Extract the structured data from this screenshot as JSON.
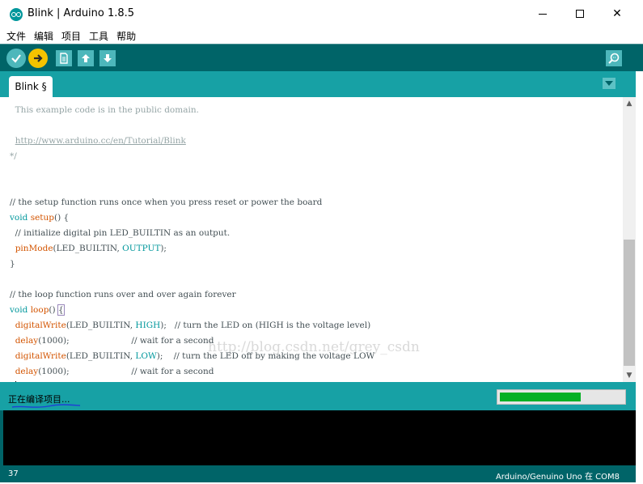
{
  "window": {
    "title": "Blink | Arduino 1.8.5",
    "min_icon": "minimize-icon",
    "max_icon": "maximize-icon",
    "close_label": "✕"
  },
  "menu": [
    "文件",
    "编辑",
    "项目",
    "工具",
    "帮助"
  ],
  "toolbar": {
    "buttons": [
      "verify-icon",
      "upload-icon",
      "new-icon",
      "open-icon",
      "save-icon",
      "serial-monitor-icon"
    ],
    "colors": {
      "background": "#006468",
      "button": "#4db7bb",
      "active": "#f4c300"
    }
  },
  "tabs": [
    {
      "label": "Blink §"
    }
  ],
  "editor": {
    "lines": [
      [
        {
          "t": "  This example code is in the public domain.",
          "c": "c-comment"
        }
      ],
      [],
      [
        {
          "t": "  ",
          "c": ""
        },
        {
          "t": "http://www.arduino.cc/en/Tutorial/Blink",
          "c": "c-link"
        }
      ],
      [
        {
          "t": "*/",
          "c": "c-comment"
        }
      ],
      [],
      [],
      [
        {
          "t": "// the setup function runs once when you press reset or power the board",
          "c": ""
        }
      ],
      [
        {
          "t": "void",
          "c": "c-type"
        },
        {
          "t": " ",
          "c": ""
        },
        {
          "t": "setup",
          "c": "c-func"
        },
        {
          "t": "() {",
          "c": ""
        }
      ],
      [
        {
          "t": "  // initialize digital pin LED_BUILTIN as an output.",
          "c": ""
        }
      ],
      [
        {
          "t": "  ",
          "c": ""
        },
        {
          "t": "pinMode",
          "c": "c-func"
        },
        {
          "t": "(LED_BUILTIN, ",
          "c": ""
        },
        {
          "t": "OUTPUT",
          "c": "c-const"
        },
        {
          "t": ");",
          "c": ""
        }
      ],
      [
        {
          "t": "}",
          "c": ""
        }
      ],
      [],
      [
        {
          "t": "// the loop function runs over and over again forever",
          "c": ""
        }
      ],
      [
        {
          "t": "void",
          "c": "c-type"
        },
        {
          "t": " ",
          "c": ""
        },
        {
          "t": "loop",
          "c": "c-func"
        },
        {
          "t": "() ",
          "c": ""
        },
        {
          "t": "{",
          "c": "brace-hl"
        }
      ],
      [
        {
          "t": "  ",
          "c": ""
        },
        {
          "t": "digitalWrite",
          "c": "c-func"
        },
        {
          "t": "(LED_BUILTIN, ",
          "c": ""
        },
        {
          "t": "HIGH",
          "c": "c-const"
        },
        {
          "t": ");   // turn the LED on (HIGH is the voltage level)",
          "c": ""
        }
      ],
      [
        {
          "t": "  ",
          "c": ""
        },
        {
          "t": "delay",
          "c": "c-func"
        },
        {
          "t": "(1000);                       // wait for a second",
          "c": ""
        }
      ],
      [
        {
          "t": "  ",
          "c": ""
        },
        {
          "t": "digitalWrite",
          "c": "c-func"
        },
        {
          "t": "(LED_BUILTIN, ",
          "c": ""
        },
        {
          "t": "LOW",
          "c": "c-const"
        },
        {
          "t": ");    // turn the LED off by making the voltage LOW",
          "c": ""
        }
      ],
      [
        {
          "t": "  ",
          "c": ""
        },
        {
          "t": "delay",
          "c": "c-func"
        },
        {
          "t": "(1000);                       // wait for a second",
          "c": ""
        }
      ],
      [
        {
          "t": "}",
          "c": ""
        },
        {
          "t": "",
          "c": "caret"
        }
      ]
    ],
    "watermark": "http://blog.csdn.net/grey_csdn"
  },
  "status": {
    "text": "正在编译项目...",
    "progress": 0.66
  },
  "footer": {
    "line_number": "37",
    "board": "Arduino/Genuino Uno 在 COM8"
  }
}
